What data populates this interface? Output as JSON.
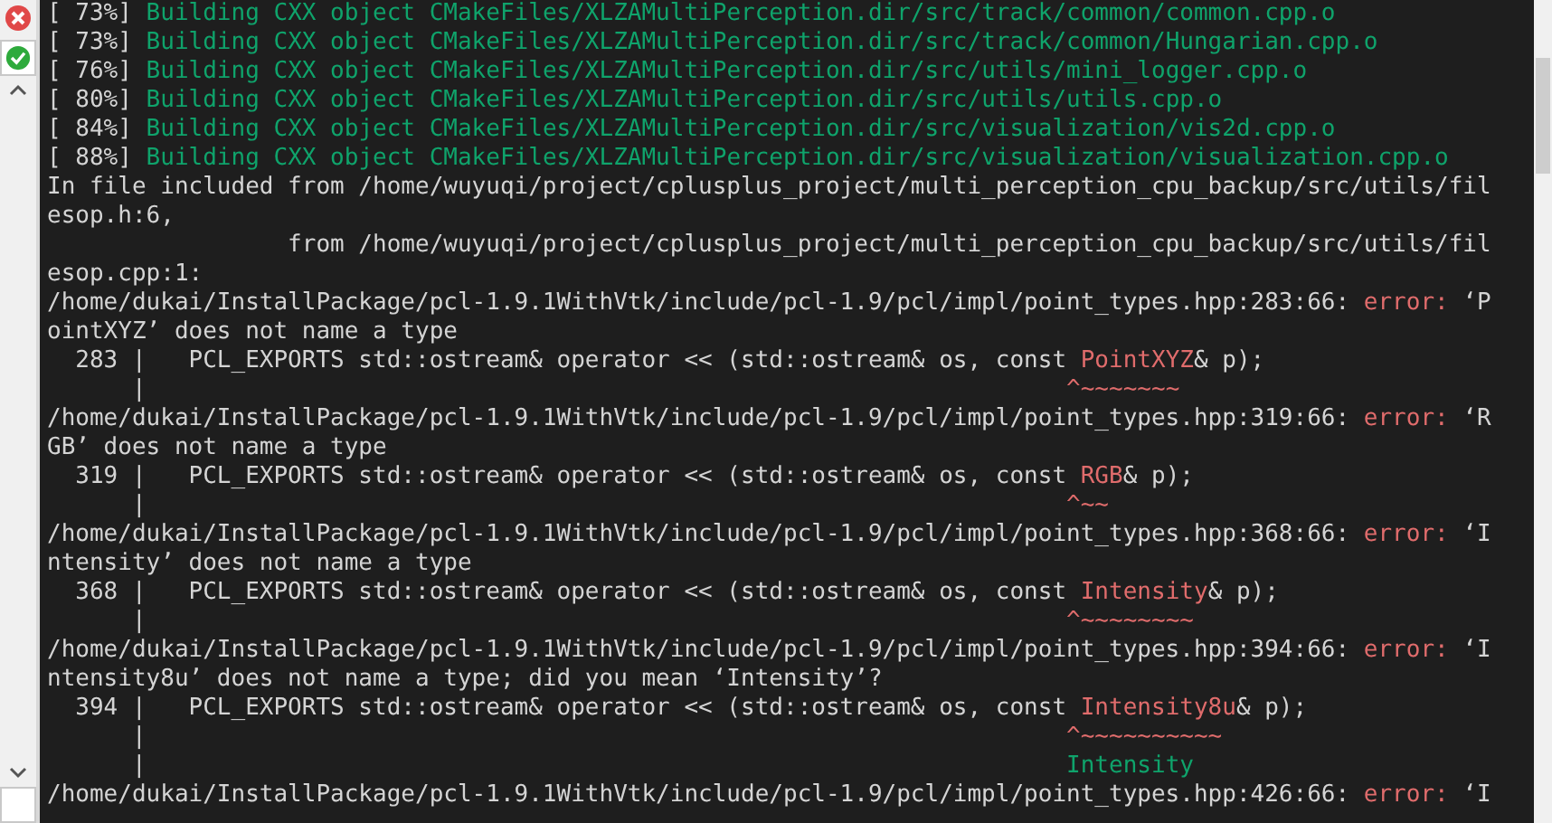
{
  "terminal": {
    "lines": [
      {
        "segments": [
          {
            "text": "[ 73%] ",
            "color": "#d4d4d4"
          },
          {
            "text": "Building CXX object CMakeFiles/XLZAMultiPerception.dir/src/track/common/common.cpp.o",
            "color": "#0fa36b"
          }
        ]
      },
      {
        "segments": [
          {
            "text": "[ 73%] ",
            "color": "#d4d4d4"
          },
          {
            "text": "Building CXX object CMakeFiles/XLZAMultiPerception.dir/src/track/common/Hungarian.cpp.o",
            "color": "#0fa36b"
          }
        ]
      },
      {
        "segments": [
          {
            "text": "[ 76%] ",
            "color": "#d4d4d4"
          },
          {
            "text": "Building CXX object CMakeFiles/XLZAMultiPerception.dir/src/utils/mini_logger.cpp.o",
            "color": "#0fa36b"
          }
        ]
      },
      {
        "segments": [
          {
            "text": "[ 80%] ",
            "color": "#d4d4d4"
          },
          {
            "text": "Building CXX object CMakeFiles/XLZAMultiPerception.dir/src/utils/utils.cpp.o",
            "color": "#0fa36b"
          }
        ]
      },
      {
        "segments": [
          {
            "text": "[ 84%] ",
            "color": "#d4d4d4"
          },
          {
            "text": "Building CXX object CMakeFiles/XLZAMultiPerception.dir/src/visualization/vis2d.cpp.o",
            "color": "#0fa36b"
          }
        ]
      },
      {
        "segments": [
          {
            "text": "[ 88%] ",
            "color": "#d4d4d4"
          },
          {
            "text": "Building CXX object CMakeFiles/XLZAMultiPerception.dir/src/visualization/visualization.cpp.o",
            "color": "#0fa36b"
          }
        ]
      },
      {
        "segments": [
          {
            "text": "In file included from /home/wuyuqi/project/cplusplus_project/multi_perception_cpu_backup/src/utils/fil",
            "color": "#d4d4d4"
          }
        ]
      },
      {
        "segments": [
          {
            "text": "esop.h:6,",
            "color": "#d4d4d4"
          }
        ]
      },
      {
        "segments": [
          {
            "text": "                 from /home/wuyuqi/project/cplusplus_project/multi_perception_cpu_backup/src/utils/fil",
            "color": "#d4d4d4"
          }
        ]
      },
      {
        "segments": [
          {
            "text": "esop.cpp:1:",
            "color": "#d4d4d4"
          }
        ]
      },
      {
        "segments": [
          {
            "text": "/home/dukai/InstallPackage/pcl-1.9.1WithVtk/include/pcl-1.9/pcl/impl/point_types.hpp:283:66: ",
            "color": "#d4d4d4"
          },
          {
            "text": "error:",
            "color": "#e06c6c"
          },
          {
            "text": " ‘P",
            "color": "#d4d4d4"
          }
        ]
      },
      {
        "segments": [
          {
            "text": "ointXYZ’ does not name a type",
            "color": "#d4d4d4"
          }
        ]
      },
      {
        "segments": [
          {
            "text": "  283 |   PCL_EXPORTS std::ostream& operator << (std::ostream& os, const ",
            "color": "#d4d4d4"
          },
          {
            "text": "PointXYZ",
            "color": "#e06c6c"
          },
          {
            "text": "& p);",
            "color": "#d4d4d4"
          }
        ]
      },
      {
        "segments": [
          {
            "text": "      |",
            "color": "#d4d4d4"
          },
          {
            "text": "                                                                 ^~~~~~~~",
            "color": "#e06c6c"
          }
        ]
      },
      {
        "segments": [
          {
            "text": "/home/dukai/InstallPackage/pcl-1.9.1WithVtk/include/pcl-1.9/pcl/impl/point_types.hpp:319:66: ",
            "color": "#d4d4d4"
          },
          {
            "text": "error:",
            "color": "#e06c6c"
          },
          {
            "text": " ‘R",
            "color": "#d4d4d4"
          }
        ]
      },
      {
        "segments": [
          {
            "text": "GB’ does not name a type",
            "color": "#d4d4d4"
          }
        ]
      },
      {
        "segments": [
          {
            "text": "  319 |   PCL_EXPORTS std::ostream& operator << (std::ostream& os, const ",
            "color": "#d4d4d4"
          },
          {
            "text": "RGB",
            "color": "#e06c6c"
          },
          {
            "text": "& p);",
            "color": "#d4d4d4"
          }
        ]
      },
      {
        "segments": [
          {
            "text": "      |",
            "color": "#d4d4d4"
          },
          {
            "text": "                                                                 ^~~",
            "color": "#e06c6c"
          }
        ]
      },
      {
        "segments": [
          {
            "text": "/home/dukai/InstallPackage/pcl-1.9.1WithVtk/include/pcl-1.9/pcl/impl/point_types.hpp:368:66: ",
            "color": "#d4d4d4"
          },
          {
            "text": "error:",
            "color": "#e06c6c"
          },
          {
            "text": " ‘I",
            "color": "#d4d4d4"
          }
        ]
      },
      {
        "segments": [
          {
            "text": "ntensity’ does not name a type",
            "color": "#d4d4d4"
          }
        ]
      },
      {
        "segments": [
          {
            "text": "  368 |   PCL_EXPORTS std::ostream& operator << (std::ostream& os, const ",
            "color": "#d4d4d4"
          },
          {
            "text": "Intensity",
            "color": "#e06c6c"
          },
          {
            "text": "& p);",
            "color": "#d4d4d4"
          }
        ]
      },
      {
        "segments": [
          {
            "text": "      |",
            "color": "#d4d4d4"
          },
          {
            "text": "                                                                 ^~~~~~~~~",
            "color": "#e06c6c"
          }
        ]
      },
      {
        "segments": [
          {
            "text": "/home/dukai/InstallPackage/pcl-1.9.1WithVtk/include/pcl-1.9/pcl/impl/point_types.hpp:394:66: ",
            "color": "#d4d4d4"
          },
          {
            "text": "error:",
            "color": "#e06c6c"
          },
          {
            "text": " ‘I",
            "color": "#d4d4d4"
          }
        ]
      },
      {
        "segments": [
          {
            "text": "ntensity8u’ does not name a type; did you mean ‘Intensity’?",
            "color": "#d4d4d4"
          }
        ]
      },
      {
        "segments": [
          {
            "text": "  394 |   PCL_EXPORTS std::ostream& operator << (std::ostream& os, const ",
            "color": "#d4d4d4"
          },
          {
            "text": "Intensity8u",
            "color": "#e06c6c"
          },
          {
            "text": "& p);",
            "color": "#d4d4d4"
          }
        ]
      },
      {
        "segments": [
          {
            "text": "      |",
            "color": "#d4d4d4"
          },
          {
            "text": "                                                                 ^~~~~~~~~~~",
            "color": "#e06c6c"
          }
        ]
      },
      {
        "segments": [
          {
            "text": "      |",
            "color": "#d4d4d4"
          },
          {
            "text": "                                                                 Intensity",
            "color": "#0fa36b"
          }
        ]
      },
      {
        "segments": [
          {
            "text": "/home/dukai/InstallPackage/pcl-1.9.1WithVtk/include/pcl-1.9/pcl/impl/point_types.hpp:426:66: ",
            "color": "#d4d4d4"
          },
          {
            "text": "error:",
            "color": "#e06c6c"
          },
          {
            "text": " ‘I",
            "color": "#d4d4d4"
          }
        ]
      }
    ]
  }
}
